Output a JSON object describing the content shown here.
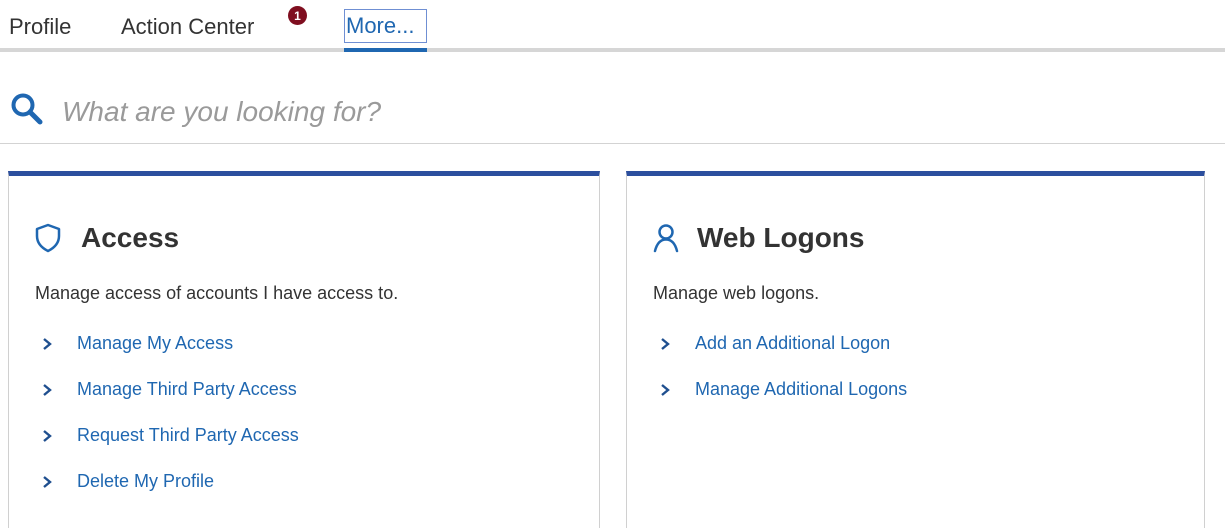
{
  "tabs": [
    {
      "label": "Profile"
    },
    {
      "label": "Action Center",
      "badge": "1"
    },
    {
      "label": "More...",
      "active": true
    }
  ],
  "colors": {
    "accent": "#1f67b1",
    "card_border_top": "#2c4f9e",
    "badge": "#7f0e1f",
    "text": "#333333"
  },
  "search": {
    "icon": "search-icon",
    "placeholder": "What are you looking for?",
    "value": ""
  },
  "cards": [
    {
      "icon": "shield-icon",
      "title": "Access",
      "description": "Manage access of accounts I have access to.",
      "links": [
        "Manage My Access",
        "Manage Third Party Access",
        "Request Third Party Access",
        "Delete My Profile"
      ]
    },
    {
      "icon": "user-icon",
      "title": "Web Logons",
      "description": "Manage web logons.",
      "links": [
        "Add an Additional Logon",
        "Manage Additional Logons"
      ]
    }
  ]
}
